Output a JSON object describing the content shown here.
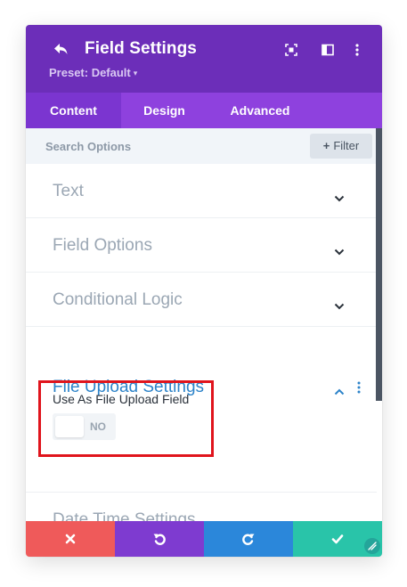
{
  "header": {
    "title": "Field Settings",
    "preset_label": "Preset: Default",
    "icons": [
      "back-arrow-icon",
      "expand-icon",
      "sidebar-layout-icon",
      "more-vertical-icon"
    ],
    "color": "#6c2eb9"
  },
  "tabs": [
    {
      "label": "Content",
      "active": true
    },
    {
      "label": "Design",
      "active": false
    },
    {
      "label": "Advanced",
      "active": false
    }
  ],
  "search": {
    "placeholder": "Search Options",
    "filter_label": "Filter"
  },
  "sections": [
    {
      "title": "Text",
      "open": false
    },
    {
      "title": "Field Options",
      "open": false
    },
    {
      "title": "Conditional Logic",
      "open": false
    },
    {
      "title": "File Upload Settings",
      "open": true
    },
    {
      "title": "Date Time Settings",
      "open": false
    }
  ],
  "file_upload": {
    "field_label": "Use As File Upload Field",
    "toggle_value": "NO"
  },
  "footer": {
    "buttons": [
      {
        "name": "discard",
        "icon": "close-icon",
        "color": "#ef5a5a"
      },
      {
        "name": "undo",
        "icon": "undo-icon",
        "color": "#7e3bd0"
      },
      {
        "name": "redo",
        "icon": "redo-icon",
        "color": "#2b87da"
      },
      {
        "name": "save",
        "icon": "check-icon",
        "color": "#29c4a9"
      }
    ]
  },
  "colors": {
    "accent_open": "#2c83c9",
    "highlight": "#e0141c",
    "tabs": "#8e41de"
  }
}
